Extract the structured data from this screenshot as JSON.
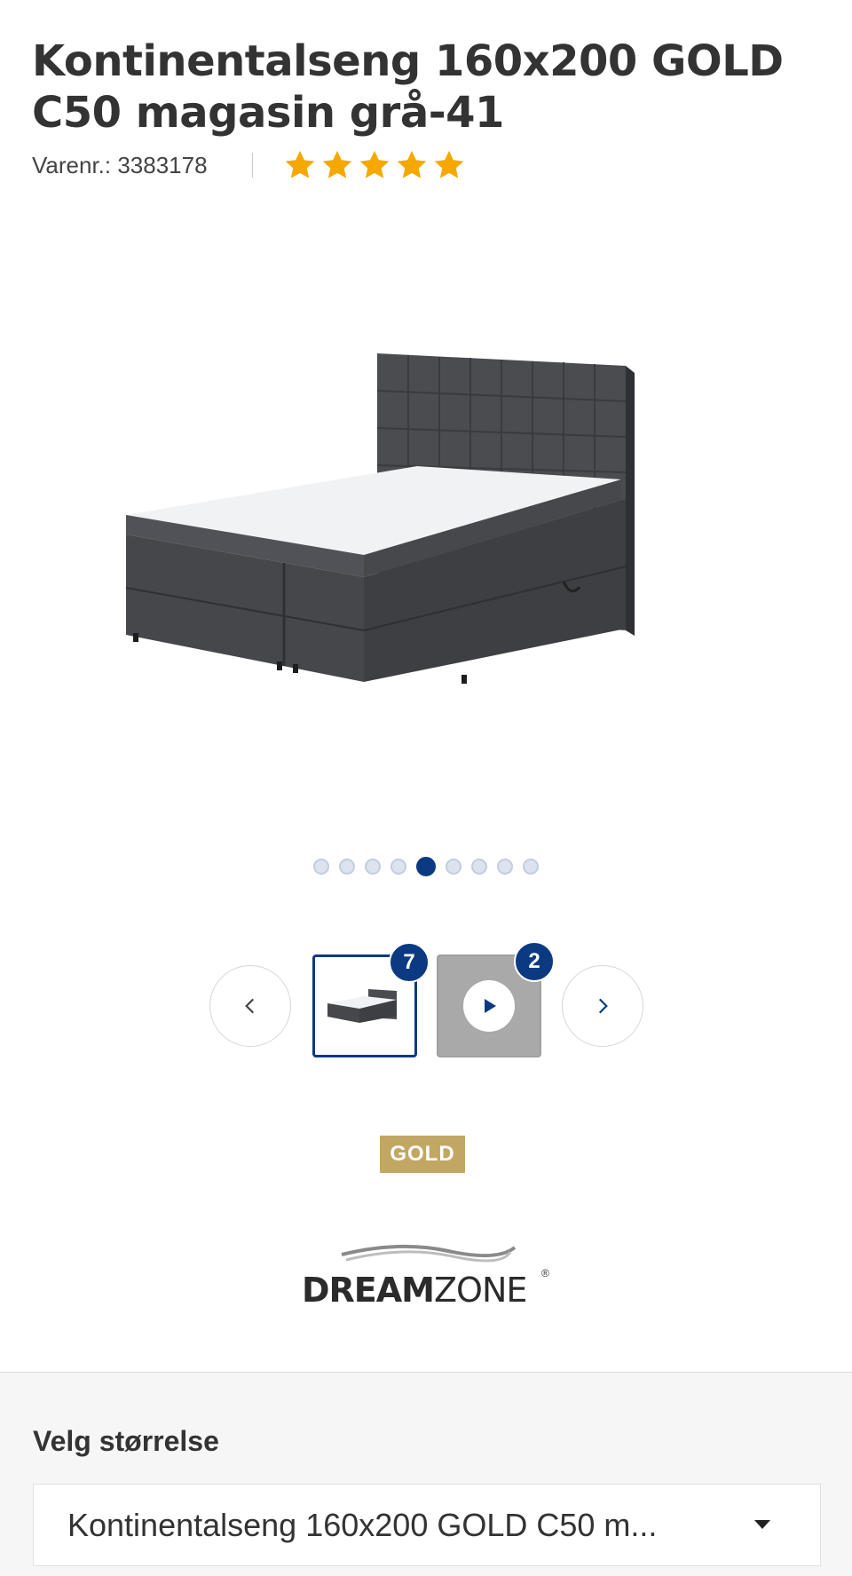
{
  "product": {
    "title": "Kontinentalseng 160x200 GOLD C50 magasin grå-41",
    "sku_text": "Varenr.: 3383178",
    "rating": {
      "value": 5,
      "max": 5
    }
  },
  "gallery": {
    "dot_count": 9,
    "active_dot_index": 4,
    "prev_icon": "chevron-left-icon",
    "next_icon": "chevron-right-icon",
    "image_thumb_count": "7",
    "video_thumb_count": "2"
  },
  "badges": {
    "gold_label": "GOLD",
    "gold_color": "#c2a764"
  },
  "brand": {
    "name_bold": "DREAM",
    "name_regular": "ZONE",
    "registered": "®"
  },
  "size_selector": {
    "label": "Velg størrelse",
    "selected_value": "Kontinentalseng 160x200 GOLD C50 m..."
  },
  "colors": {
    "accent": "#0c3a82",
    "star": "#f5a800"
  }
}
